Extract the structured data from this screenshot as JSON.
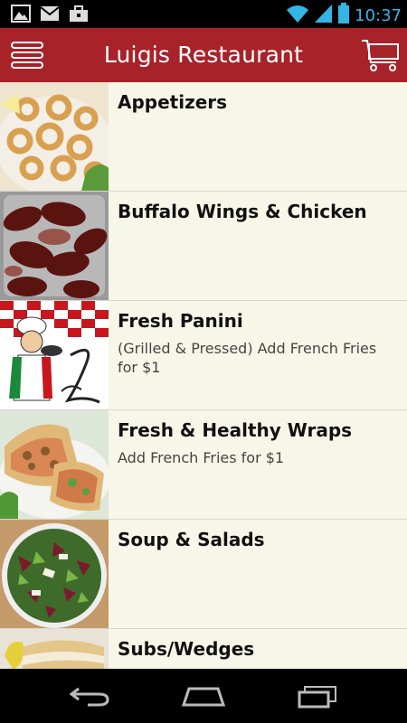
{
  "status_bar": {
    "time": "10:37",
    "left_icons": [
      "picture-icon",
      "gmail-icon",
      "briefcase-icon"
    ],
    "right_icons": [
      "wifi-icon",
      "signal-icon",
      "battery-icon"
    ],
    "accent_color": "#33b5e5"
  },
  "app_bar": {
    "title": "Luigis Restaurant",
    "background_color": "#a8222a",
    "menu_icon": "hamburger-menu-icon",
    "cart_icon": "shopping-cart-icon"
  },
  "menu_categories": [
    {
      "name": "Appetizers",
      "description": "",
      "image": "fried-calamari-image"
    },
    {
      "name": "Buffalo Wings & Chicken",
      "description": "",
      "image": "buffalo-wings-image"
    },
    {
      "name": "Fresh Panini",
      "description": "(Grilled & Pressed) Add French Fries for $1",
      "image": "luigis-chef-logo-image"
    },
    {
      "name": "Fresh & Healthy Wraps",
      "description": "Add French Fries for $1",
      "image": "chicken-wrap-image"
    },
    {
      "name": "Soup & Salads",
      "description": "",
      "image": "salad-image"
    },
    {
      "name": "Subs/Wedges",
      "description": "",
      "image": "sub-sandwich-image"
    }
  ],
  "nav_bar": {
    "buttons": [
      "back-icon",
      "home-icon",
      "recent-apps-icon"
    ]
  }
}
